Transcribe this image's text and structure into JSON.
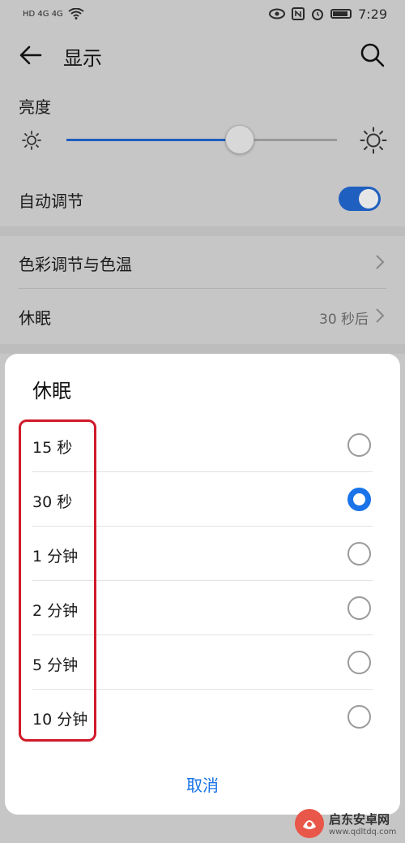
{
  "status_bar": {
    "left_indicators": "HD 4G 4G",
    "time": "7:29"
  },
  "header": {
    "title": "显示"
  },
  "brightness": {
    "label": "亮度",
    "level_fraction": 0.64
  },
  "auto_adjust": {
    "label": "自动调节",
    "enabled": true
  },
  "color": {
    "label": "色彩调节与色温"
  },
  "sleep_row": {
    "label": "休眠",
    "value": "30 秒后"
  },
  "dialog": {
    "title": "休眠",
    "options": [
      {
        "label": "15 秒",
        "selected": false
      },
      {
        "label": "30 秒",
        "selected": true
      },
      {
        "label": "1 分钟",
        "selected": false
      },
      {
        "label": "2 分钟",
        "selected": false
      },
      {
        "label": "5 分钟",
        "selected": false
      },
      {
        "label": "10 分钟",
        "selected": false
      }
    ],
    "cancel_label": "取消"
  },
  "watermark": {
    "name": "启东安卓网",
    "url": "www.qdltdq.com"
  },
  "colors": {
    "accent": "#1a73e8",
    "highlight": "#d11a2a"
  }
}
